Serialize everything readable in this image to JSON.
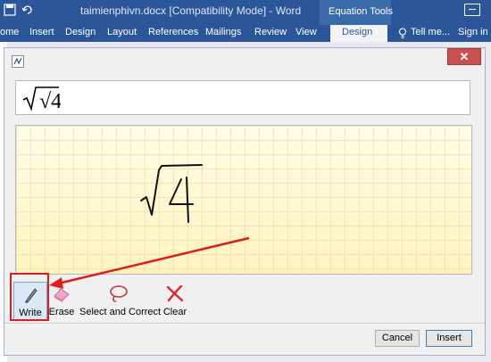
{
  "titlebar": {
    "document_title": "taimienphivn.docx [Compatibility Mode] - Word",
    "context_tab": "Equation Tools"
  },
  "ribbon": {
    "tabs": [
      "ome",
      "Insert",
      "Design",
      "Layout",
      "References",
      "Mailings",
      "Review",
      "View"
    ],
    "active_tab": "Design",
    "tell_me": "Tell me...",
    "sign_in": "Sign in"
  },
  "dialog": {
    "preview_expression": "√4",
    "tools": {
      "write": "Write",
      "erase": "Erase",
      "select_and_correct": "Select and Correct",
      "clear": "Clear"
    },
    "buttons": {
      "cancel": "Cancel",
      "insert": "Insert"
    }
  },
  "colors": {
    "word_blue": "#2b579a",
    "canvas_yellow": "#fff6cc",
    "highlight_red": "#e01b1b",
    "close_red": "#c75050"
  }
}
